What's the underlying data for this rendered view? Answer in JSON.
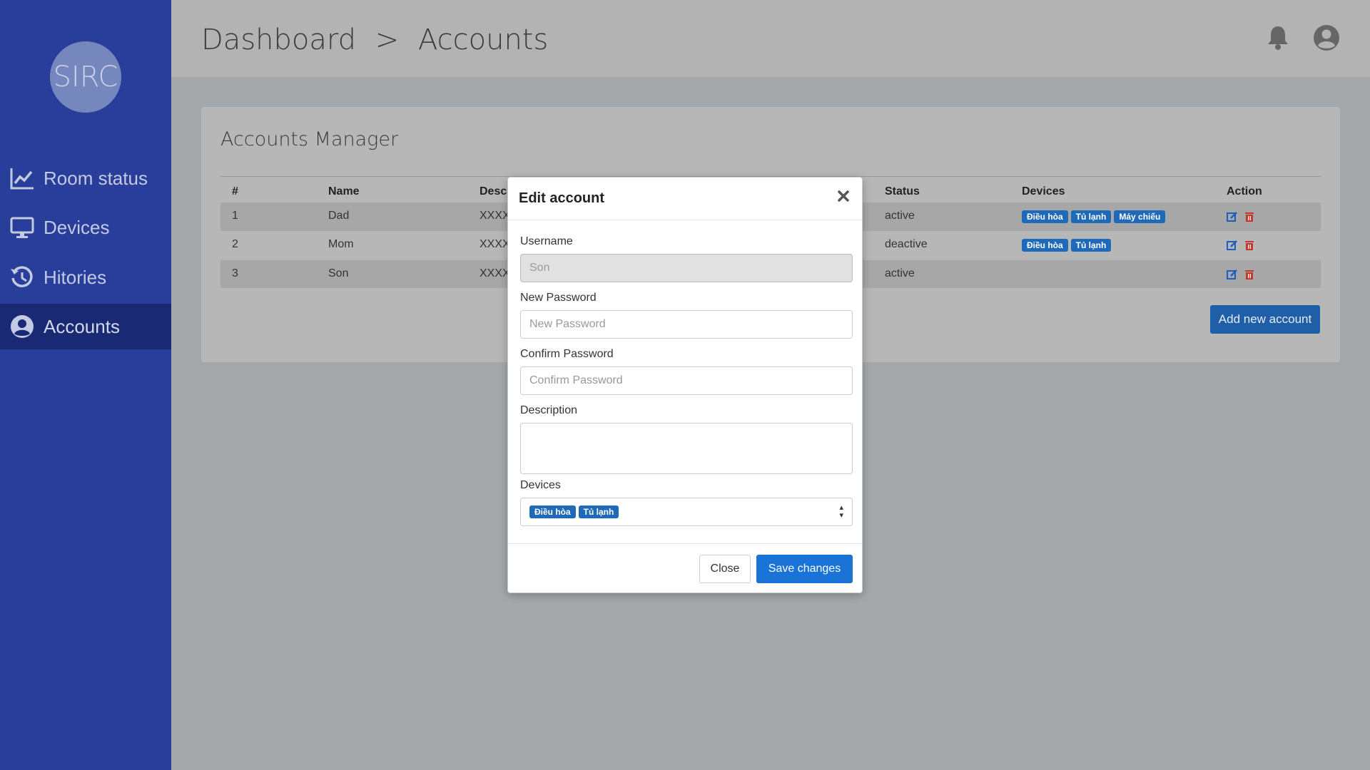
{
  "sidebar": {
    "logo": "SIRC",
    "items": [
      {
        "label": "Room status",
        "icon": "chart-line-icon"
      },
      {
        "label": "Devices",
        "icon": "monitor-icon"
      },
      {
        "label": "Hitories",
        "icon": "history-icon"
      },
      {
        "label": "Accounts",
        "icon": "user-circle-icon",
        "active": true
      }
    ]
  },
  "header": {
    "crumb_root": "Dashboard",
    "separator": ">",
    "crumb_current": "Accounts"
  },
  "card": {
    "title": "Accounts Manager",
    "columns": {
      "num": "#",
      "name": "Name",
      "desc": "Desc",
      "status": "Status",
      "devices": "Devices",
      "action": "Action"
    },
    "rows": [
      {
        "num": "1",
        "name": "Dad",
        "desc": "XXXX",
        "status": "active",
        "devices": [
          "Điều hòa",
          "Tủ lạnh",
          "Máy chiếu"
        ]
      },
      {
        "num": "2",
        "name": "Mom",
        "desc": "XXXX",
        "status": "deactive",
        "devices": [
          "Điều hòa",
          "Tủ lạnh"
        ]
      },
      {
        "num": "3",
        "name": "Son",
        "desc": "XXXX",
        "status": "active",
        "devices": []
      }
    ],
    "add_button": "Add new account"
  },
  "modal": {
    "title": "Edit account",
    "username_label": "Username",
    "username_value": "Son",
    "new_password_label": "New Password",
    "new_password_placeholder": "New Password",
    "confirm_password_label": "Confirm Password",
    "confirm_password_placeholder": "Confirm Password",
    "description_label": "Description",
    "devices_label": "Devices",
    "devices_selected": [
      "Điều hòa",
      "Tủ lạnh"
    ],
    "close_button": "Close",
    "save_button": "Save changes"
  },
  "colors": {
    "sidebar": "#293e9b",
    "sidebar_active": "#1a2973",
    "primary": "#1a73d6",
    "badge": "#1f6ab8",
    "danger": "#c0392b"
  }
}
